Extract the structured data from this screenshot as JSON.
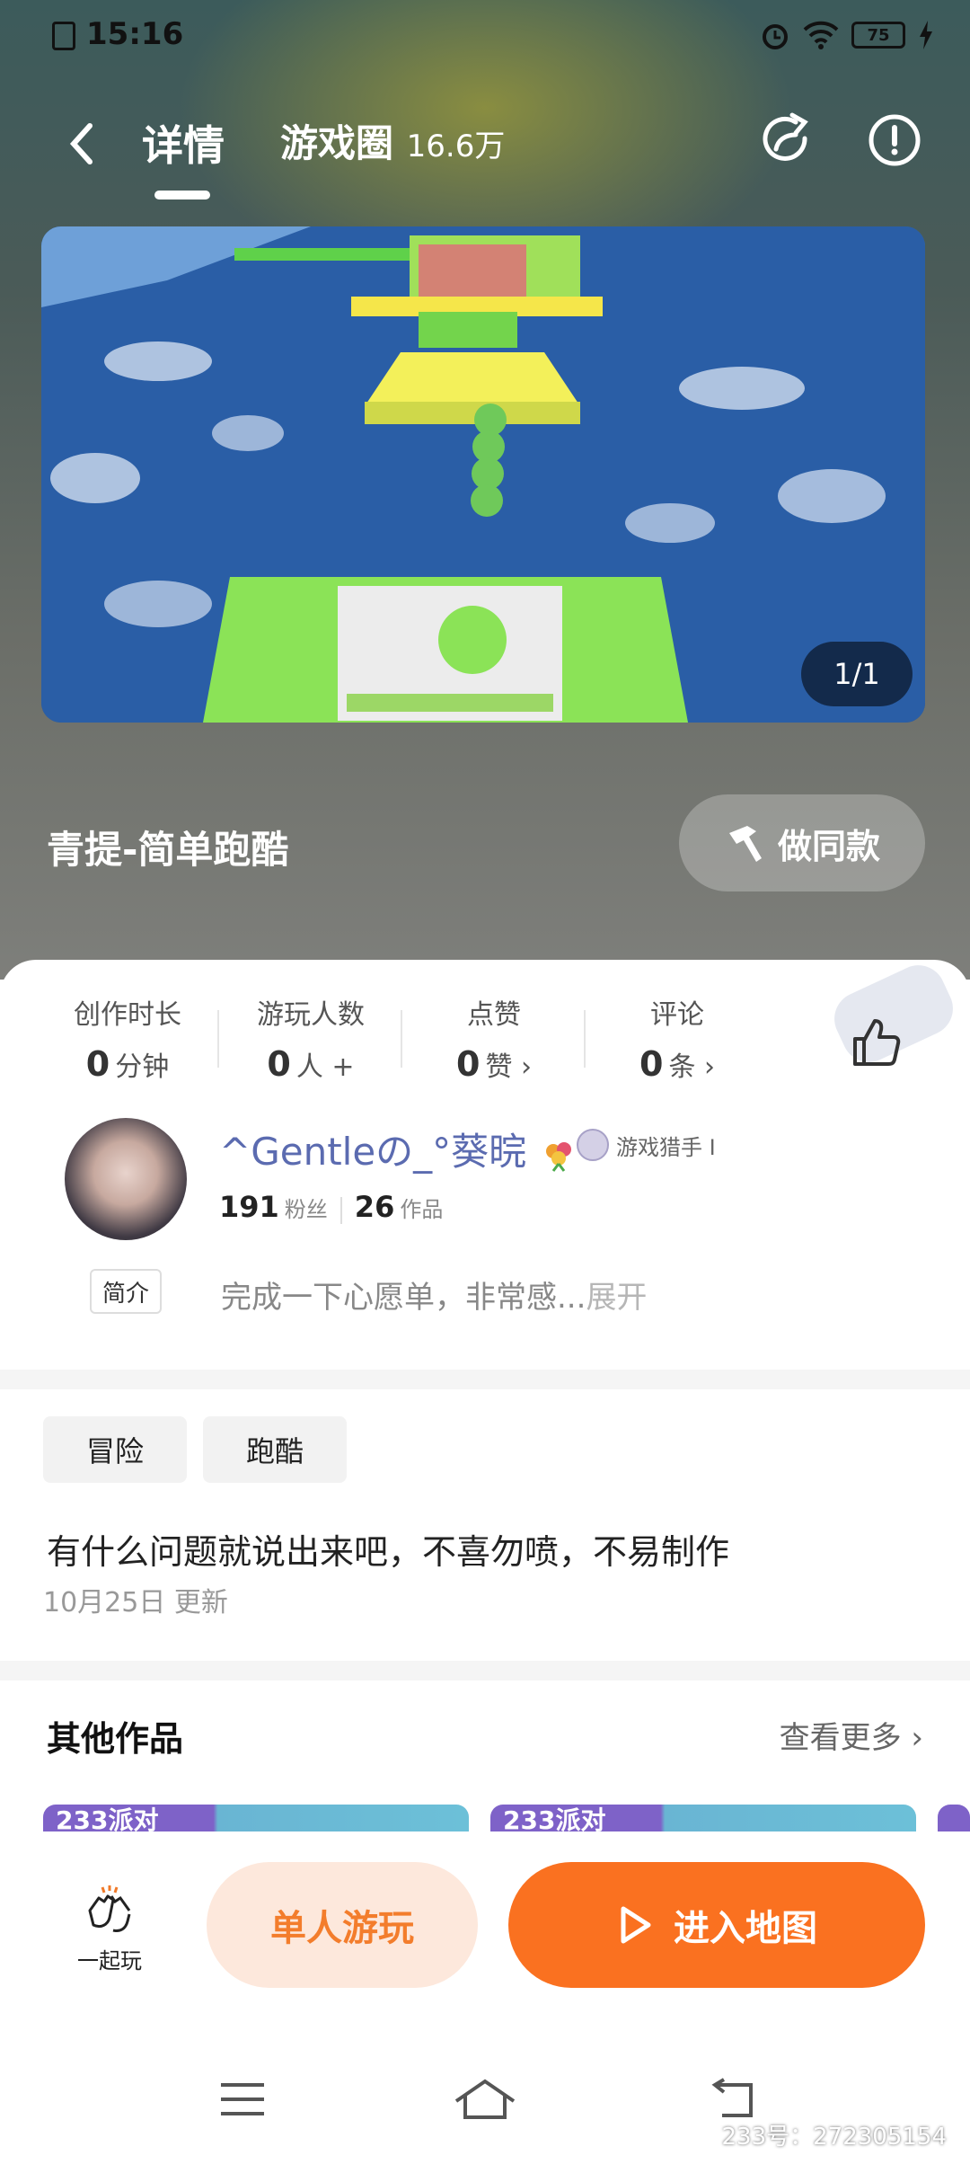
{
  "status_bar": {
    "time": "15:16",
    "battery": "75"
  },
  "nav": {
    "tab_details": "详情",
    "tab_circle": "游戏圈",
    "circle_count": "16.6万"
  },
  "media": {
    "pager": "1/1"
  },
  "game": {
    "title": "青提-简单跑酷",
    "remake_label": "做同款"
  },
  "stats": [
    {
      "label": "创作时长",
      "value": "0",
      "unit": "分钟"
    },
    {
      "label": "游玩人数",
      "value": "0",
      "unit": "人 +"
    },
    {
      "label": "点赞",
      "value": "0",
      "unit": "赞 ›"
    },
    {
      "label": "评论",
      "value": "0",
      "unit": "条 ›"
    }
  ],
  "author": {
    "name": "^Gentleの_°葵晥",
    "badge": "游戏猎手 I",
    "fans": "191",
    "fans_label": "粉丝",
    "works": "26",
    "works_label": "作品"
  },
  "intro": {
    "tag": "简介",
    "text": "完成一下心愿单，非常感...",
    "more": "展开"
  },
  "tags": [
    "冒险",
    "跑酷"
  ],
  "description": "有什么问题就说出来吧，不喜勿喷，不易制作",
  "updated": "10月25日 更新",
  "others": {
    "title": "其他作品",
    "see_more": "查看更多 ›",
    "card_label": "233派对"
  },
  "actions": {
    "together": "一起玩",
    "solo": "单人游玩",
    "enter": "进入地图"
  },
  "watermark": "233号：272305154"
}
